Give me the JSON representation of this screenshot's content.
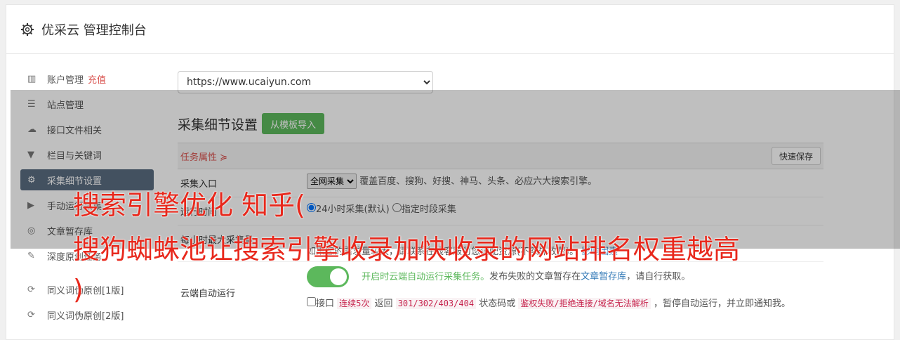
{
  "header": {
    "title": "优采云 管理控制台",
    "icon": "gear-icon"
  },
  "sidebar": {
    "items": [
      {
        "label": "账户管理",
        "extra": "充值",
        "icon": "bar-chart-icon"
      },
      {
        "label": "站点管理",
        "icon": "server-icon"
      },
      {
        "label": "接口文件相关",
        "icon": "cloud-upload-icon"
      },
      {
        "label": "栏目与关键词",
        "icon": "filter-icon"
      },
      {
        "label": "采集细节设置",
        "icon": "cogs-icon"
      },
      {
        "label": "手动运行采集",
        "icon": "play-circle-icon"
      },
      {
        "label": "文章暂存库",
        "icon": "database-icon"
      },
      {
        "label": "深度原创任务",
        "icon": "edit-icon"
      }
    ],
    "items2": [
      {
        "label": "同义词伪原创[1版]",
        "icon": "refresh-icon"
      },
      {
        "label": "同义词伪原创[2版]",
        "icon": "refresh-icon"
      }
    ]
  },
  "main": {
    "url_select": "https://www.ucaiyun.com",
    "section_title": "采集细节设置",
    "import_button": "从模板导入",
    "task_label": "任务属性 ≽",
    "save_button": "快速保存",
    "rows": {
      "entry_label": "采集入口",
      "entry_select": "全网采集",
      "entry_desc": "覆盖百度、搜狗、好搜、神马、头条、必应六大搜索引擎。",
      "time_label": "运行时间",
      "time_opt1": "24小时采集(默认)",
      "time_opt2": "指定时段采集",
      "limit_label": "每小时最大采集量",
      "limit_desc": "如果您的需求量较大，请联系在线客服为您调配资源(不额外收费)。",
      "limit_link": "影响因素",
      "cloud_label": "云端自动运行",
      "cloud_status": "开启时云端自动运行采集任务。",
      "cloud_desc1": "发布失败的文章暂存在",
      "cloud_link": "文章暂存库",
      "cloud_desc2": "，请自行获取。",
      "api_prefix": "接口",
      "api_code1": "连续5次",
      "api_mid1": "返回",
      "api_code2": "301/302/403/404",
      "api_mid2": "状态码或",
      "api_code3": "鉴权失败/拒绝连接/域名无法解析",
      "api_suffix": "，暂停自动运行，并立即通知我。"
    }
  },
  "overlay": {
    "line1": "搜索引擎优化 知乎(",
    "line2": "搜狗蜘蛛池让搜索引擎收录加快收录的网站排名权重越高",
    "line3": ")"
  },
  "colors": {
    "accent_green": "#5cb85c",
    "active_sidebar": "#5a6c80",
    "red": "#d9534f"
  }
}
